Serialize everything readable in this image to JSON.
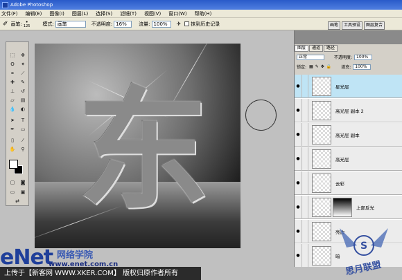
{
  "titlebar": {
    "title": "Adobe Photoshop"
  },
  "menu": [
    "文件(F)",
    "编辑(E)",
    "图像(I)",
    "图层(L)",
    "选择(S)",
    "滤镜(T)",
    "视图(V)",
    "窗口(W)",
    "帮助(H)"
  ],
  "options": {
    "brush_label": "画笔:",
    "brush_size": "125",
    "mode_label": "模式:",
    "mode_value": "画笔",
    "opacity_label": "不透明度:",
    "opacity_value": "16%",
    "flow_label": "流量:",
    "flow_value": "100%",
    "history_label": "抹到历史记录"
  },
  "dock": [
    "画笔",
    "工具预设",
    "图层复合"
  ],
  "panel": {
    "tabs": [
      "图层",
      "通道",
      "路径"
    ],
    "blend_mode": "正常",
    "opacity_label": "不透明度:",
    "opacity_value": "100%",
    "lock_label": "锁定:",
    "fill_label": "填充:",
    "fill_value": "100%"
  },
  "layers": [
    {
      "name": "星光层",
      "selected": true
    },
    {
      "name": "高光层 副本 2"
    },
    {
      "name": "高光层 副本"
    },
    {
      "name": "高光层"
    },
    {
      "name": "云彩"
    },
    {
      "name": "上部反光"
    },
    {
      "name": "亮边"
    },
    {
      "name": "暗"
    }
  ],
  "canvas": {
    "glyph": "东"
  },
  "watermark": {
    "logo": "eNet",
    "cn_name": "网络学院",
    "url": "www.enet.com.cn",
    "stamp": "思月联盟"
  },
  "footer": {
    "text": "上传于【新客网 WWW.XKER.COM】 版权归原作者所有"
  }
}
